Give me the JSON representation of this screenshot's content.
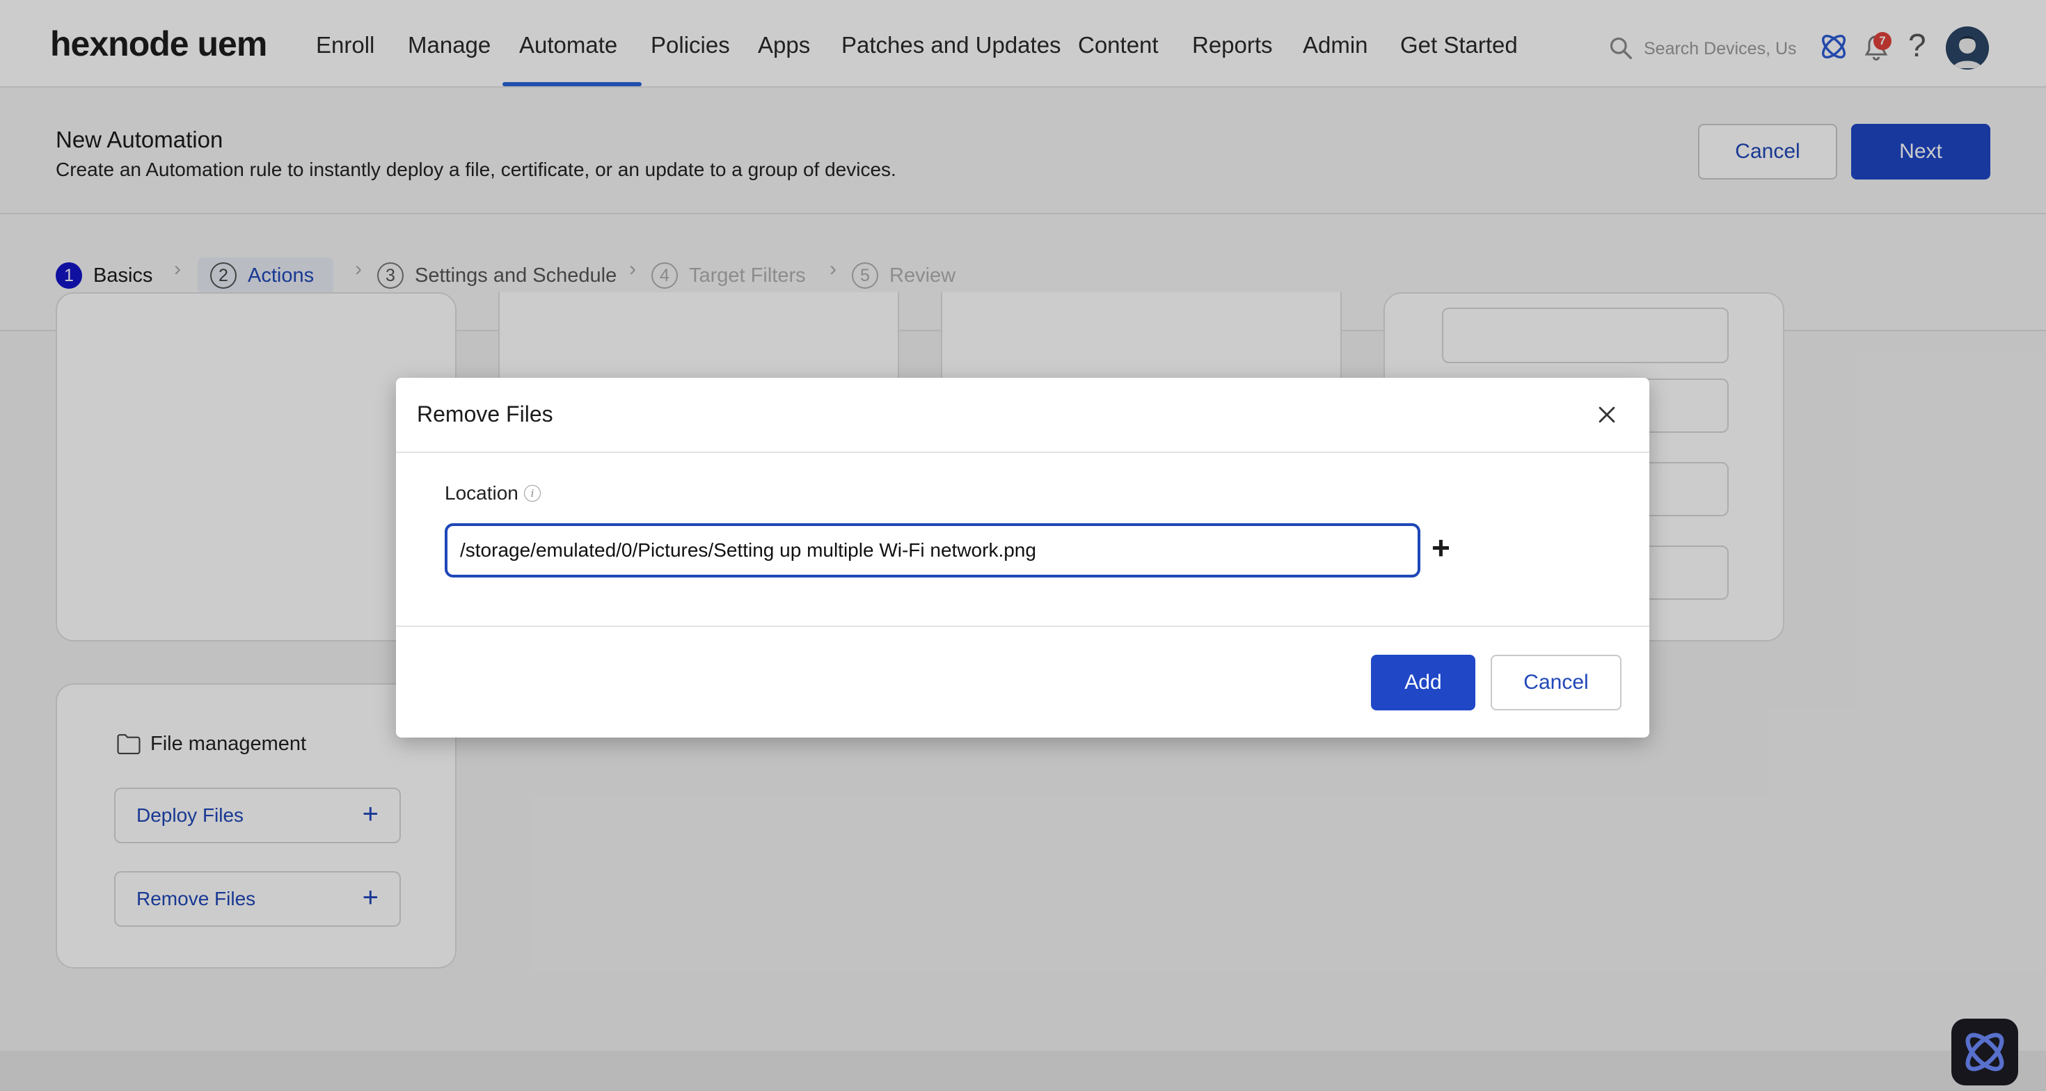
{
  "app": {
    "logo": "hexnode uem"
  },
  "nav": {
    "items": [
      "Enroll",
      "Manage",
      "Automate",
      "Policies",
      "Apps",
      "Patches and Updates",
      "Content",
      "Reports",
      "Admin",
      "Get Started"
    ],
    "active": "Automate",
    "search_placeholder": "Search Devices, Use",
    "notification_count": "7",
    "help": "?"
  },
  "header": {
    "title": "New Automation",
    "subtitle": "Create an Automation rule to instantly deploy a file, certificate, or an update to a group of devices.",
    "cancel_label": "Cancel",
    "next_label": "Next"
  },
  "stepper": {
    "steps": [
      {
        "num": "1",
        "label": "Basics",
        "state": "done"
      },
      {
        "num": "2",
        "label": "Actions",
        "state": "current"
      },
      {
        "num": "3",
        "label": "Settings and Schedule",
        "state": "pending"
      },
      {
        "num": "4",
        "label": "Target Filters",
        "state": "muted"
      },
      {
        "num": "5",
        "label": "Review",
        "state": "muted"
      }
    ],
    "separator": "›"
  },
  "content": {
    "file_management": {
      "title": "File management",
      "actions": [
        {
          "label": "Deploy Files"
        },
        {
          "label": "Remove Files"
        }
      ],
      "plus": "+"
    }
  },
  "modal": {
    "title": "Remove Files",
    "field_label": "Location",
    "info": "i",
    "location_value": "/storage/emulated/0/Pictures/Setting up multiple Wi-Fi network.png",
    "add_more": "+",
    "add_label": "Add",
    "cancel_label": "Cancel"
  },
  "colors": {
    "accent": "#1f47b8",
    "primary_button": "#1f47c6",
    "badge": "#e0403a",
    "step_done": "#1414c8"
  }
}
